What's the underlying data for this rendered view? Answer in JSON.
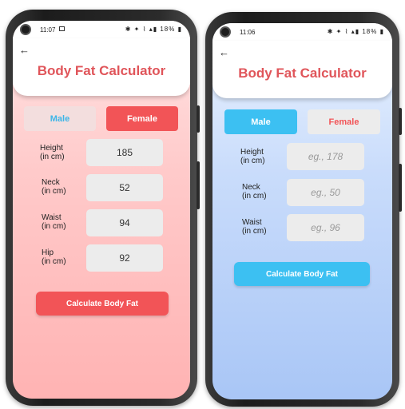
{
  "colors": {
    "accent_red": "#f25457",
    "accent_blue": "#3cc0f2",
    "title_red": "#e0555a",
    "bg_left": "#ffc5c5",
    "bg_right": "#b4cdf8"
  },
  "left_screen": {
    "status": {
      "time": "11:07",
      "right": "✱ ✦ ⌇ ▴▮ 18% ▮"
    },
    "back_icon": "arrow-left-icon",
    "title": "Body Fat Calculator",
    "gender": {
      "male": "Male",
      "female": "Female",
      "selected": "female"
    },
    "fields": [
      {
        "label_line1": "Height",
        "label_line2": "(in cm)",
        "value": "185"
      },
      {
        "label_line1": "Neck",
        "label_line2": "(in cm)",
        "value": "52"
      },
      {
        "label_line1": "Waist",
        "label_line2": "(in cm)",
        "value": "94"
      },
      {
        "label_line1": "Hip",
        "label_line2": "(in cm)",
        "value": "92"
      }
    ],
    "calculate_label": "Calculate Body Fat"
  },
  "right_screen": {
    "status": {
      "time": "11:06",
      "right": "✱ ✦ ⌇ ▴▮ 18% ▮"
    },
    "back_icon": "arrow-left-icon",
    "title": "Body Fat Calculator",
    "gender": {
      "male": "Male",
      "female": "Female",
      "selected": "male"
    },
    "fields": [
      {
        "label_line1": "Height",
        "label_line2": "(in cm)",
        "placeholder": "eg., 178"
      },
      {
        "label_line1": "Neck",
        "label_line2": "(in cm)",
        "placeholder": "eg., 50"
      },
      {
        "label_line1": "Waist",
        "label_line2": "(in cm)",
        "placeholder": "eg., 96"
      }
    ],
    "calculate_label": "Calculate Body Fat"
  }
}
